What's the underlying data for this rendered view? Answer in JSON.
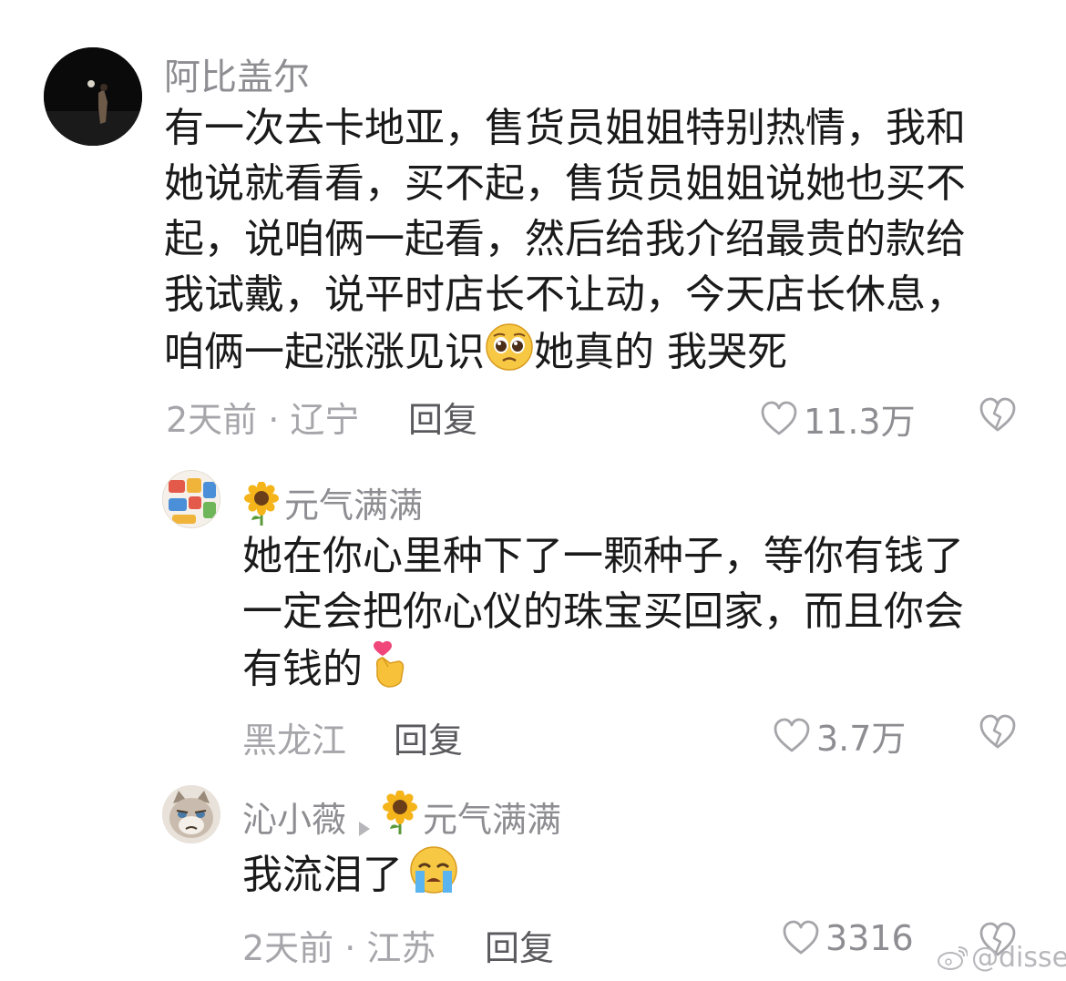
{
  "comments": [
    {
      "username": "阿比盖尔",
      "avatar_icon": "night-photo-avatar",
      "lines": [
        "有一次去卡地亚，售货员姐姐特别热情，我和",
        "她说就看看，买不起，售货员姐姐说她也买不",
        "起，说咱俩一起看，然后给我介绍最贵的款给",
        "我试戴，说平时店长不让动，今天店长休息，",
        "咱俩一起涨涨见识"
      ],
      "line_suffix_after_emoji": "她真的 我哭死",
      "emoji_icon": "pleading-face-icon",
      "meta": "2天前 · 辽宁",
      "reply_label": "回复",
      "like_count": "11.3万"
    },
    {
      "username": "元气满满",
      "username_icon": "sunflower-icon",
      "avatar_icon": "sticker-collage-avatar",
      "lines": [
        "她在你心里种下了一颗种子，等你有钱了",
        "一定会把你心仪的珠宝买回家，而且你会",
        "有钱的"
      ],
      "emoji_icon": "finger-heart-icon",
      "meta": "黑龙江",
      "reply_label": "回复",
      "like_count": "3.7万"
    },
    {
      "username": "沁小薇",
      "reply_to_icon": "triangle-right-icon",
      "reply_to_username": "元气满满",
      "reply_to_username_icon": "sunflower-icon",
      "avatar_icon": "grumpy-cat-avatar",
      "lines": [
        "我流泪了"
      ],
      "emoji_icon": "crying-face-icon",
      "meta": "2天前 · 江苏",
      "reply_label": "回复",
      "like_count": "3316"
    }
  ],
  "watermark": {
    "icon": "weibo-logo-icon",
    "text": "@disse"
  },
  "colors": {
    "username": "#8d8d92",
    "meta": "#a5a5aa",
    "reply": "#5a5a5e",
    "body": "#1a1a1a"
  }
}
